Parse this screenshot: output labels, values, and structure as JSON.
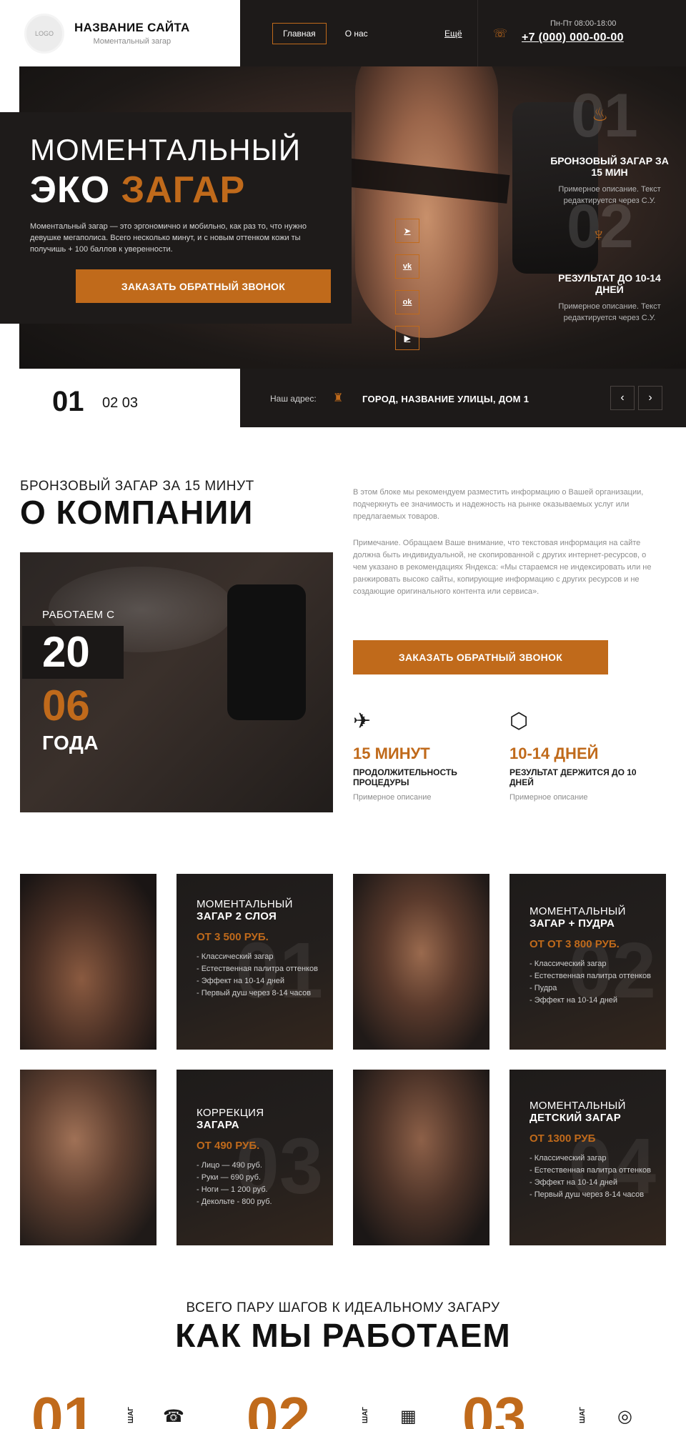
{
  "header": {
    "logo_text": "LOGO",
    "site_name": "НАЗВАНИЕ САЙТА",
    "site_sub": "Моментальный загар",
    "nav": {
      "home": "Главная",
      "about": "О нас",
      "more": "Ещё"
    },
    "hours": "Пн-Пт 08:00-18:00",
    "phone": "+7 (000) 000-00-00",
    "phone_icon": "☏"
  },
  "hero": {
    "title_line1": "МОМЕНТАЛЬНЫЙ",
    "title_eco": "ЭКО",
    "title_tan": "ЗАГАР",
    "description": "Моментальный загар — это эргономично и мобильно, как раз то, что нужно девушке мегаполиса. Всего несколько минут, и с новым оттенком кожи ты получишь + 100 баллов к уверенности.",
    "button": "ЗАКАЗАТЬ ОБРАТНЫЙ ЗВОНОК",
    "socials": [
      {
        "icon": "telegram-icon",
        "glyph": "➤"
      },
      {
        "icon": "vk-icon",
        "glyph": "vk"
      },
      {
        "icon": "odnoklassniki-icon",
        "glyph": "ok"
      },
      {
        "icon": "youtube-icon",
        "glyph": "▶"
      }
    ],
    "features": [
      {
        "num": "01",
        "icon": "bottle-icon",
        "glyph": "♨",
        "title": "БРОНЗОВЫЙ ЗАГАР ЗА 15 МИН",
        "desc": "Примерное описание. Текст редактируется через С.У."
      },
      {
        "num": "02",
        "icon": "candle-icon",
        "glyph": "♆",
        "title": "РЕЗУЛЬТАТ ДО 10-14 ДНЕЙ",
        "desc": "Примерное описание. Текст редактируется через С.У."
      }
    ]
  },
  "slider": {
    "current": "01",
    "rest": "02 03",
    "address_label": "Наш адрес:",
    "address": "ГОРОД, НАЗВАНИЕ УЛИЦЫ, ДОМ 1",
    "address_icon": "♜",
    "prev": "‹",
    "next": "›"
  },
  "about": {
    "subtitle": "БРОНЗОВЫЙ ЗАГАР ЗА 15 МИНУТ",
    "title": "О КОМПАНИИ",
    "paragraph1": "В этом блоке мы рекомендуем разместить информацию о Вашей организации, подчеркнуть ее значимость и надежность на рынке оказываемых услуг или предлагаемых товаров.",
    "paragraph2": "Примечание. Обращаем Ваше внимание, что текстовая информация на сайте должна быть индивидуальной, не скопированной с других интернет-ресурсов, о чем указано в рекомендациях Яндекса: «Мы стараемся не индексировать или не ранжировать высоко сайты, копирующие информацию с других ресурсов и не создающие оригинального контента или сервиса».",
    "work_label": "РАБОТАЕМ С",
    "year1": "20",
    "year2": "06",
    "year3": "ГОДА",
    "button": "ЗАКАЗАТЬ ОБРАТНЫЙ ЗВОНОК",
    "stats": [
      {
        "icon": "spray-gun-icon",
        "glyph": "✈",
        "num": "15 МИНУТ",
        "title": "ПРОДОЛЖИТЕЛЬНОСТЬ ПРОЦЕДУРЫ",
        "desc": "Примерное описание"
      },
      {
        "icon": "hexagons-icon",
        "glyph": "⬡",
        "num": "10-14 ДНЕЙ",
        "title": "РЕЗУЛЬТАТ ДЕРЖИТСЯ ДО 10 ДНЕЙ",
        "desc": "Примерное описание"
      }
    ]
  },
  "prices": [
    {
      "num": "01",
      "t1": "МОМЕНТАЛЬНЫЙ",
      "t2": "ЗАГАР 2 СЛОЯ",
      "price": "ОТ 3 500 РУБ.",
      "items": [
        "- Классический загар",
        "- Естественная палитра оттенков",
        "- Эффект на 10-14 дней",
        "- Первый душ через 8-14 часов"
      ]
    },
    {
      "num": "02",
      "t1": "МОМЕНТАЛЬНЫЙ",
      "t2": "ЗАГАР + ПУДРА",
      "price": "ОТ ОТ 3 800 РУБ.",
      "items": [
        "- Классический загар",
        "- Естественная палитра оттенков",
        "- Пудра",
        "- Эффект на 10-14 дней"
      ]
    },
    {
      "num": "03",
      "t1": "КОРРЕКЦИЯ",
      "t2": "ЗАГАРА",
      "price": "ОТ 490 РУБ.",
      "items": [
        "- Лицо — 490 руб.",
        "- Руки — 690 руб.",
        "- Ноги — 1 200 руб.",
        "- Декольте - 800 руб."
      ]
    },
    {
      "num": "04",
      "t1": "МОМЕНТАЛЬНЫЙ",
      "t2": "ДЕТСКИЙ ЗАГАР",
      "price": "ОТ 1300 РУБ",
      "items": [
        "- Классический загар",
        "- Естественная палитра оттенков",
        "- Эффект на 10-14 дней",
        "- Первый душ через 8-14 часов"
      ]
    }
  ],
  "how": {
    "subtitle": "ВСЕГО ПАРУ ШАГОВ К ИДЕАЛЬНОМУ ЗАГАРУ",
    "title": "КАК МЫ РАБОТАЕМ",
    "steps": [
      {
        "num": "01",
        "label": "ШАГ",
        "icon": "phone-icon",
        "glyph": "☎"
      },
      {
        "num": "02",
        "label": "ШАГ",
        "icon": "calendar-icon",
        "glyph": "▦"
      },
      {
        "num": "03",
        "label": "ШАГ",
        "icon": "target-icon",
        "glyph": "◎"
      }
    ]
  },
  "colors": {
    "accent": "#c06a1b",
    "dark": "#1d1a19"
  }
}
